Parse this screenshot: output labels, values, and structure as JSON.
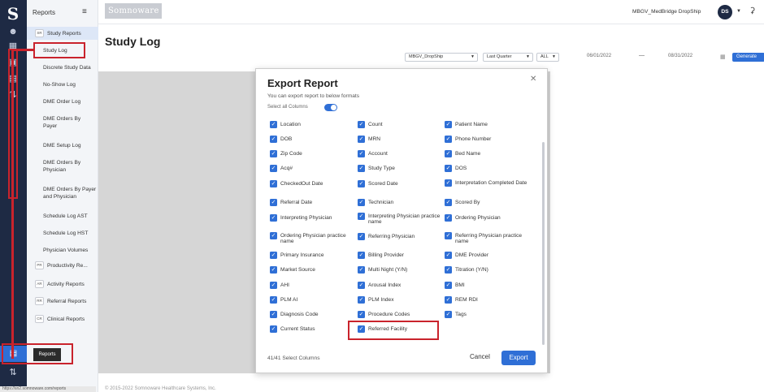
{
  "brand": "Somnoware",
  "org_name": "MBGV_MedBridge DropShip",
  "user_initials": "DS",
  "sidebar": {
    "title": "Reports",
    "items": [
      {
        "label": "Study Reports",
        "badge": "SR"
      },
      {
        "label": "Study Log",
        "badge": ""
      },
      {
        "label": "Discrete Study Data",
        "badge": ""
      },
      {
        "label": "No-Show Log",
        "badge": ""
      },
      {
        "label": "DME Order Log",
        "badge": ""
      },
      {
        "label": "DME Orders By Payer",
        "badge": ""
      },
      {
        "label": "DME Setup Log",
        "badge": ""
      },
      {
        "label": "DME Orders By Physician",
        "badge": ""
      },
      {
        "label": "DME Orders By Payer and Physician",
        "badge": ""
      },
      {
        "label": "Schedule Log AST",
        "badge": ""
      },
      {
        "label": "Schedule Log HST",
        "badge": ""
      },
      {
        "label": "Physician Volumes",
        "badge": ""
      },
      {
        "label": "Productivity Re...",
        "badge": "PR"
      },
      {
        "label": "Activity Reports",
        "badge": "AR"
      },
      {
        "label": "Referral Reports",
        "badge": "RR"
      },
      {
        "label": "Clinical Reports",
        "badge": "CR"
      }
    ]
  },
  "rail_tooltip": "Reports",
  "page_title": "Study Log",
  "filters": {
    "location": "MBGV_DropShip",
    "period": "Last Quarter",
    "scope": "ALL",
    "start_date": "06/01/2022",
    "end_date": "08/31/2022",
    "generate_label": "Generate"
  },
  "modal": {
    "title": "Export Report",
    "subtitle": "You can export report to below formats",
    "select_all_label": "Select all Columns",
    "columns": [
      [
        "Location",
        "DOB",
        "Zip Code",
        "Acq#",
        "CheckedOut Date",
        "Referral Date",
        "Interpreting Physician",
        "Ordering Physician practice name",
        "Primary Insurance",
        "Market Source",
        "AHI",
        "PLM AI",
        "Diagnosis Code",
        "Current Status"
      ],
      [
        "Count",
        "MRN",
        "Account",
        "Study Type",
        "Scored Date",
        "Technician",
        "Interpreting Physician practice name",
        "Referring Physician",
        "Billing Provider",
        "Multi Night (Y/N)",
        "Arousal Index",
        "PLM Index",
        "Procedure Codes",
        "Referred Facility"
      ],
      [
        "Patient Name",
        "Phone Number",
        "Bed Name",
        "DOS",
        "Interpretation Completed Date",
        "Scored By",
        "Ordering Physician",
        "Referring Physician practice name",
        "DME Provider",
        "Titration (Y/N)",
        "BMI",
        "REM RDI",
        "Tags"
      ]
    ],
    "selected_count": "41/41 Select Columns",
    "cancel_label": "Cancel",
    "export_label": "Export"
  },
  "footer_text": "© 2015-2022 Somnoware Healthcare Systems, Inc.",
  "status_url": "https://sn2.somnoware.com/reports",
  "colors": {
    "accent": "#2f6fd6",
    "rail": "#1e2a44",
    "annotation": "#c9232c"
  }
}
